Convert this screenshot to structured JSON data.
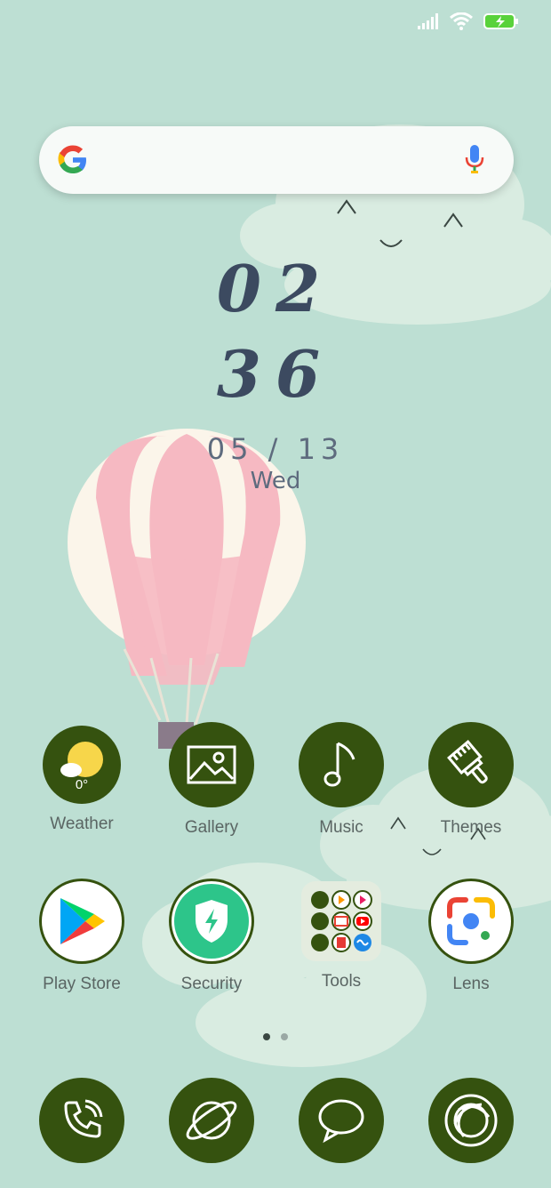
{
  "status_bar": {
    "signal_icon": "signal-icon",
    "wifi_icon": "wifi-icon",
    "battery_icon": "battery-charging-icon"
  },
  "search": {
    "logo": "google-logo",
    "mic_icon": "mic-icon"
  },
  "clock": {
    "hours": "02",
    "minutes": "36",
    "date": "05 / 13",
    "weekday": "Wed"
  },
  "apps_row1": [
    {
      "label": "Weather",
      "temp": "0°"
    },
    {
      "label": "Gallery"
    },
    {
      "label": "Music"
    },
    {
      "label": "Themes"
    }
  ],
  "apps_row2": [
    {
      "label": "Play Store"
    },
    {
      "label": "Security"
    },
    {
      "label": "Tools"
    },
    {
      "label": "Lens"
    }
  ],
  "dock": [
    {
      "name": "phone-icon"
    },
    {
      "name": "browser-icon"
    },
    {
      "name": "messages-icon"
    },
    {
      "name": "camera-icon"
    }
  ],
  "page_indicator": {
    "pages": 2,
    "current": 1
  },
  "colors": {
    "background": "#bddfd3",
    "icon_bg": "#35520f",
    "clock": "#3c4a60",
    "balloon_pink": "#f6b9c2",
    "balloon_cream": "#fbf5ea"
  }
}
